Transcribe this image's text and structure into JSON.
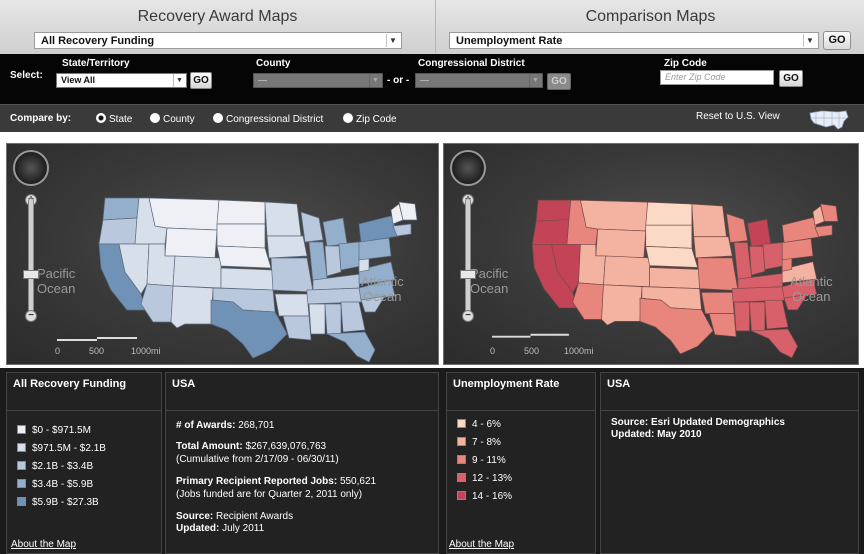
{
  "left_header": {
    "title": "Recovery Award Maps",
    "dropdown_value": "All Recovery Funding"
  },
  "right_header": {
    "title": "Comparison Maps",
    "dropdown_value": "Unemployment Rate",
    "go_label": "GO"
  },
  "select_bar": {
    "select_label": "Select:",
    "state_label": "State/Territory",
    "state_value": "View All",
    "state_go": "GO",
    "county_label": "County",
    "county_value": "—",
    "or_text": "- or -",
    "district_label": "Congressional District",
    "district_value": "—",
    "district_go": "GO",
    "zip_label": "Zip Code",
    "zip_placeholder": "Enter Zip Code",
    "zip_go": "GO"
  },
  "compare_bar": {
    "label": "Compare by:",
    "options": [
      "State",
      "County",
      "Congressional District",
      "Zip Code"
    ],
    "selected": "State",
    "reset_label": "Reset to U.S. View"
  },
  "maps": {
    "pacific_label": "Pacific\nOcean",
    "atlantic_label": "Atlantic\nOcean",
    "scale_ticks": [
      "0",
      "500",
      "1000mi"
    ],
    "left_colors": {
      "c1": "#eef0f6",
      "c2": "#d7dfeb",
      "c3": "#b9c8dc",
      "c4": "#94afcc",
      "c5": "#6f92b6"
    },
    "right_colors": {
      "c1": "#fbd9c7",
      "c2": "#f4b3a0",
      "c3": "#e8857c",
      "c4": "#d7606a",
      "c5": "#c24456"
    }
  },
  "panels": {
    "legend_left": {
      "title": "All Recovery Funding",
      "items": [
        "$0 - $971.5M",
        "$971.5M - $2.1B",
        "$2.1B - $3.4B",
        "$3.4B - $5.9B",
        "$5.9B - $27.3B"
      ],
      "link": "About the Map"
    },
    "info_left": {
      "title": "USA",
      "awards_label": "# of Awards:",
      "awards_value": "268,701",
      "amount_label": "Total Amount:",
      "amount_value": "$267,639,076,763",
      "amount_note": "(Cumulative from 2/17/09 - 06/30/11)",
      "jobs_label": "Primary Recipient Reported Jobs:",
      "jobs_value": "550,621",
      "jobs_note": "(Jobs funded are for Quarter 2, 2011 only)",
      "source_label": "Source:",
      "source_value": "Recipient Awards",
      "updated_label": "Updated:",
      "updated_value": "July 2011"
    },
    "legend_right": {
      "title": "Unemployment Rate",
      "items": [
        "4 - 6%",
        "7 - 8%",
        "9 - 11%",
        "12 - 13%",
        "14 - 16%"
      ],
      "link": "About the Map"
    },
    "info_right": {
      "title": "USA",
      "source_label": "Source:",
      "source_value": "Esri Updated Demographics",
      "updated_label": "Updated:",
      "updated_value": "May 2010"
    }
  }
}
